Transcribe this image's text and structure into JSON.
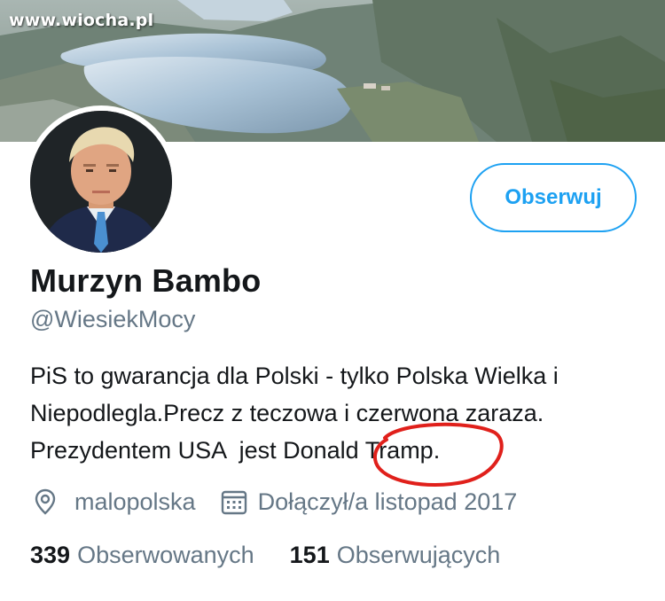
{
  "watermark": "www.wiocha.pl",
  "profile": {
    "display_name": "Murzyn Bambo",
    "handle": "@WiesiekMocy",
    "bio_lines": [
      "PiS to gwarancja dla Polski - tylko Polska Wielka i",
      "Niepodlegla.Precz z teczowa i czerwona zaraza.",
      "Prezydentem USA  jest Donald Tramp."
    ],
    "location": "malopolska",
    "joined": "Dołączył/a listopad 2017"
  },
  "actions": {
    "follow_label": "Obserwuj"
  },
  "stats": {
    "following_count": "339",
    "following_label": "Obserwowanych",
    "followers_count": "151",
    "followers_label": "Obserwujących"
  },
  "icons": {
    "location": "location-pin-icon",
    "calendar": "calendar-icon"
  },
  "colors": {
    "accent": "#1da1f2",
    "text_primary": "#14171a",
    "text_secondary": "#657786",
    "annotation": "#e0201b"
  }
}
